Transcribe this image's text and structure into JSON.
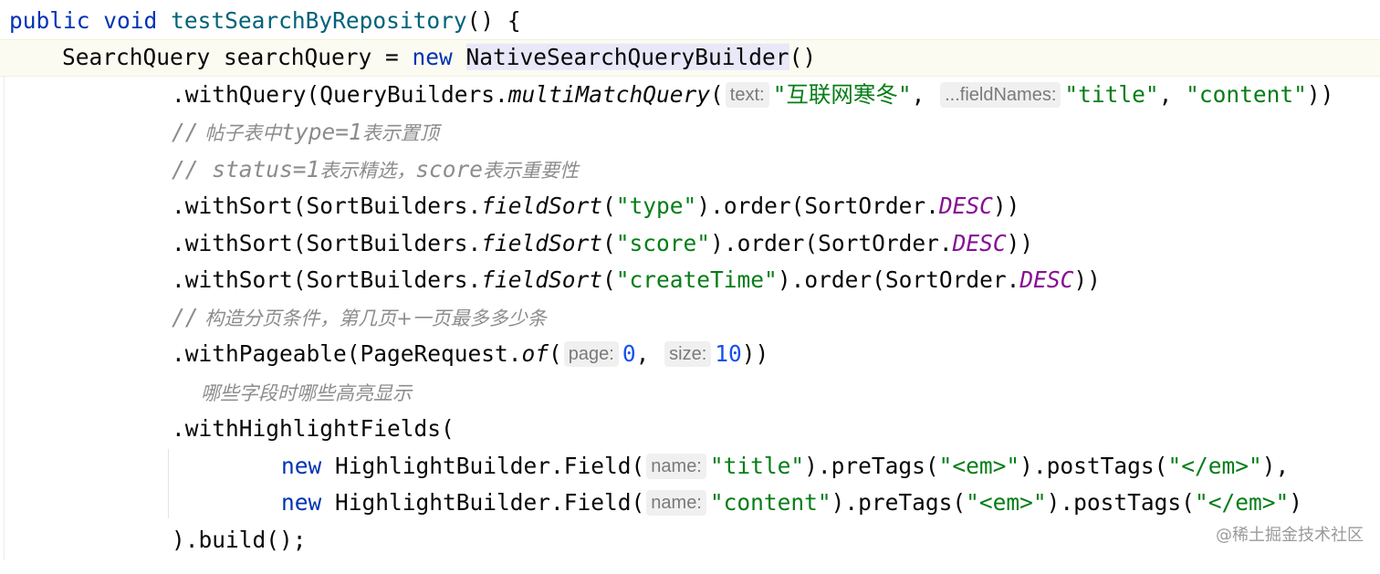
{
  "lines": [
    {
      "id": "l1",
      "segments": [
        "public",
        " ",
        "void",
        " ",
        "testSearchByRepository",
        "() {"
      ]
    },
    {
      "id": "l2",
      "segments": [
        "SearchQuery searchQuery = ",
        "new",
        " ",
        "NativeSearchQueryBuilder",
        "()"
      ]
    },
    {
      "id": "l3",
      "segments": [
        ".withQuery(QueryBuilders.",
        "multiMatchQuery",
        "(",
        "text:",
        "\"互联网寒冬\"",
        ", ",
        "...fieldNames:",
        "\"title\"",
        ", ",
        "\"content\"",
        "))"
      ]
    },
    {
      "id": "l4",
      "segments": [
        "//",
        " 帖子表中",
        "type=1",
        "表示置顶"
      ]
    },
    {
      "id": "l5",
      "segments": [
        "// status=1",
        "表示精选，",
        "score",
        "表示重要性"
      ]
    },
    {
      "id": "l6",
      "segments": [
        ".withSort(SortBuilders.",
        "fieldSort",
        "(",
        "\"type\"",
        ").order(SortOrder.",
        "DESC",
        "))"
      ]
    },
    {
      "id": "l7",
      "segments": [
        ".withSort(SortBuilders.",
        "fieldSort",
        "(",
        "\"score\"",
        ").order(SortOrder.",
        "DESC",
        "))"
      ]
    },
    {
      "id": "l8",
      "segments": [
        ".withSort(SortBuilders.",
        "fieldSort",
        "(",
        "\"createTime\"",
        ").order(SortOrder.",
        "DESC",
        "))"
      ]
    },
    {
      "id": "l9",
      "segments": [
        "//",
        " 构造分页条件，第几页+一页最多多少条"
      ]
    },
    {
      "id": "l10",
      "segments": [
        ".withPageable(PageRequest.",
        "of",
        "(",
        "page:",
        "0",
        ", ",
        "size:",
        "10",
        "))"
      ]
    },
    {
      "id": "l11",
      "segments": [
        "哪些字段时哪些高亮显示"
      ]
    },
    {
      "id": "l12",
      "segments": [
        ".withHighlightFields("
      ]
    },
    {
      "id": "l13",
      "segments": [
        "new",
        " HighlightBuilder.Field(",
        "name:",
        "\"title\"",
        ").preTags(",
        "\"<em>\"",
        ").postTags(",
        "\"</em>\"",
        "),"
      ]
    },
    {
      "id": "l14",
      "segments": [
        "new",
        " HighlightBuilder.Field(",
        "name:",
        "\"content\"",
        ").preTags(",
        "\"<em>\"",
        ").postTags(",
        "\"</em>\"",
        ")"
      ]
    },
    {
      "id": "l15",
      "segments": [
        ").build();"
      ]
    }
  ],
  "watermark": "@稀土掘金技术社区",
  "colors": {
    "keyword": "#0033b3",
    "method_decl": "#00627a",
    "string": "#067d17",
    "number": "#1750eb",
    "constant": "#871094",
    "comment": "#8c8c8c",
    "current_line": "#fbfbf2"
  }
}
